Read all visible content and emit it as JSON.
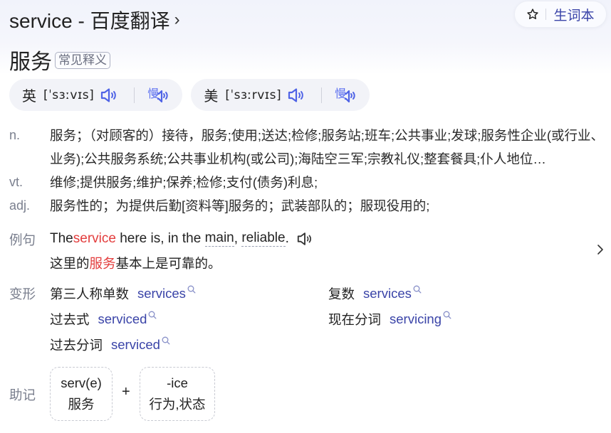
{
  "header": {
    "title": "service - 百度翻译",
    "vocab_button_label": "生词本",
    "icons": {
      "vocab": "star-icon",
      "title": "chevron-right-icon"
    }
  },
  "main_meaning": {
    "word": "服务",
    "tag": "常见释义"
  },
  "phonetics": [
    {
      "region": "英",
      "ipa": "[ˈsɜːvɪs]",
      "icons": [
        "speaker-icon",
        "slow-speaker-icon"
      ],
      "slow_label": "慢"
    },
    {
      "region": "美",
      "ipa": "[ˈsɜːrvɪs]",
      "icons": [
        "speaker-icon",
        "slow-speaker-icon"
      ],
      "slow_label": "慢"
    }
  ],
  "definitions": [
    {
      "pos": "n.",
      "text": "服务；（对顾客的）接待，服务;使用;送达;检修;服务站;班车;公共事业;发球;服务性企业(或行业、业务);公共服务系统;公共事业机构(或公司);海陆空三军;宗教礼仪;整套餐具;仆人地位…"
    },
    {
      "pos": "vt.",
      "text": "维修;提供服务;维护;保养;检修;支付(债务)利息;"
    },
    {
      "pos": "adj.",
      "text": "服务性的；为提供后勤[资料等]服务的；武装部队的；服现役用的;"
    }
  ],
  "example": {
    "label": "例句",
    "en_parts": [
      {
        "text": "The ",
        "style": "plain"
      },
      {
        "text": "service",
        "style": "highlight"
      },
      {
        "text": " here is, in the ",
        "style": "plain"
      },
      {
        "text": "main",
        "style": "dashed"
      },
      {
        "text": ", ",
        "style": "plain"
      },
      {
        "text": "reliable",
        "style": "dashed"
      },
      {
        "text": ".",
        "style": "plain"
      }
    ],
    "zh_parts": [
      {
        "text": "这里的",
        "style": "plain"
      },
      {
        "text": "服务",
        "style": "highlight"
      },
      {
        "text": "基本上是可靠的。",
        "style": "plain"
      }
    ],
    "icons": [
      "speaker-icon",
      "chevron-right-icon"
    ]
  },
  "word_forms": {
    "label": "变形",
    "items": [
      {
        "name": "第三人称单数",
        "word": "services"
      },
      {
        "name": "复数",
        "word": "services"
      },
      {
        "name": "过去式",
        "word": "serviced"
      },
      {
        "name": "现在分词",
        "word": "servicing"
      },
      {
        "name": "过去分词",
        "word": "serviced"
      }
    ]
  },
  "mnemonic": {
    "label": "助记",
    "parts": [
      {
        "root": "serv(e)",
        "meaning": "服务"
      },
      {
        "root": "-ice",
        "meaning": "行为,状态"
      }
    ],
    "joiner": "+"
  },
  "colors": {
    "accent_blue": "#3a44a8",
    "icon_blue": "#4f63e6",
    "highlight_red": "#e33d3d",
    "label_gray": "#7a7f8e"
  }
}
